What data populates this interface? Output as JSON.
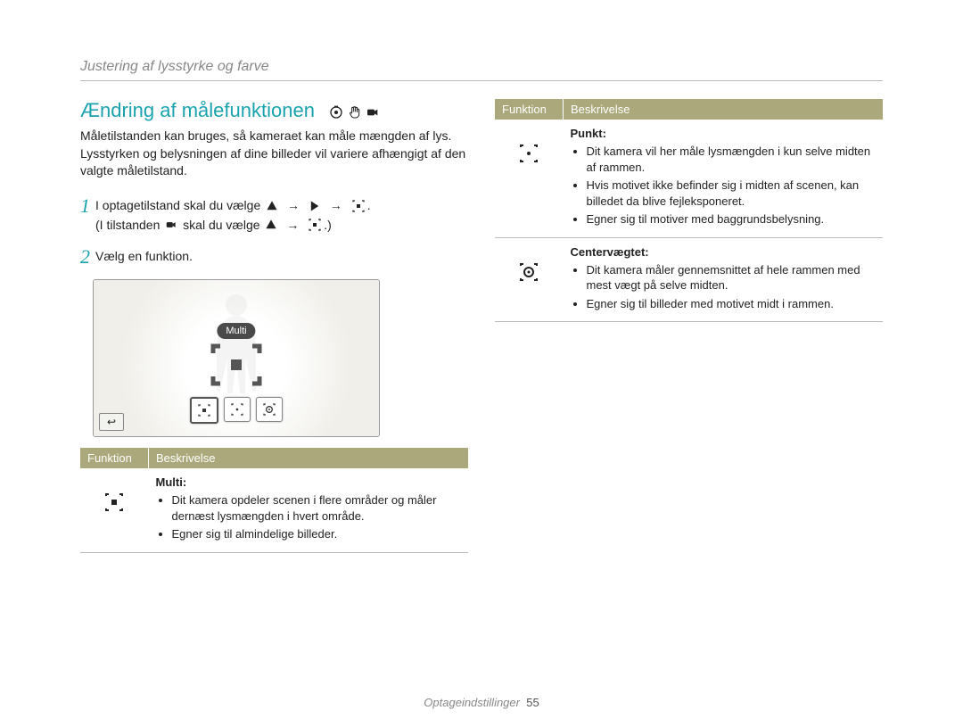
{
  "header_title": "Justering af lysstyrke og farve",
  "title": "Ændring af målefunktionen",
  "intro": "Måletilstanden kan bruges, så kameraet kan måle mængden af lys. Lysstyrken og belysningen af dine billeder vil variere afhængigt af den valgte måletilstand.",
  "steps": {
    "one_num": "1",
    "one_part1": "I optagetilstand skal du vælge",
    "one_part2": ".",
    "one_sub_part1": "(I tilstanden",
    "one_sub_part2": "skal du vælge",
    "one_sub_part3": ".)",
    "two_num": "2",
    "two_text": "Vælg en funktion."
  },
  "screenshot": {
    "label": "Multi",
    "back_symbol": "↩"
  },
  "table": {
    "header_function": "Funktion",
    "header_description": "Beskrivelse",
    "multi": {
      "name": "Multi",
      "b1": "Dit kamera opdeler scenen i flere områder og måler dernæst lysmængden i hvert område.",
      "b2": "Egner sig til almindelige billeder."
    },
    "punkt": {
      "name": "Punkt",
      "b1": "Dit kamera vil her måle lysmængden i kun selve midten af rammen.",
      "b2": "Hvis motivet ikke befinder sig i midten af scenen, kan billedet da blive fejleksponeret.",
      "b3": "Egner sig til motiver med baggrundsbelysning."
    },
    "center": {
      "name": "Centervægtet",
      "b1": "Dit kamera måler gennemsnittet af hele rammen med mest vægt på selve midten.",
      "b2": "Egner sig til billeder med motivet midt i rammen."
    }
  },
  "footer": {
    "section": "Optageindstillinger",
    "page": "55"
  }
}
